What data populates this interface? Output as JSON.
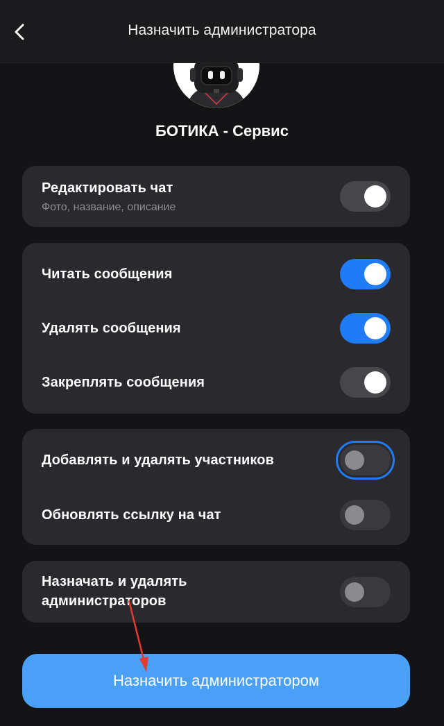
{
  "header": {
    "back_icon": "chevron-left-icon",
    "title": "Назначить администратора"
  },
  "profile": {
    "avatar_icon": "robot-avatar",
    "name": "БОТИКА - Сервис"
  },
  "groups": [
    {
      "rows": [
        {
          "label": "Редактировать чат",
          "sublabel": "Фото, название, описание",
          "state": "on-neutral"
        }
      ]
    },
    {
      "rows": [
        {
          "label": "Читать сообщения",
          "state": "on"
        },
        {
          "label": "Удалять сообщения",
          "state": "on"
        },
        {
          "label": "Закреплять сообщения",
          "state": "on-neutral"
        }
      ]
    },
    {
      "rows": [
        {
          "label": "Добавлять и удалять участников",
          "state": "off-focused"
        },
        {
          "label": "Обновлять ссылку на чат",
          "state": "off"
        }
      ]
    },
    {
      "rows": [
        {
          "label": "Назначать и удалять администраторов",
          "state": "off"
        }
      ]
    }
  ],
  "primary_button": {
    "label": "Назначить администратором"
  },
  "colors": {
    "accent": "#1f7cf6",
    "button": "#4aa0f7",
    "card": "#2a2a2e",
    "background": "#141416",
    "annotation_arrow": "#e53a2f"
  }
}
